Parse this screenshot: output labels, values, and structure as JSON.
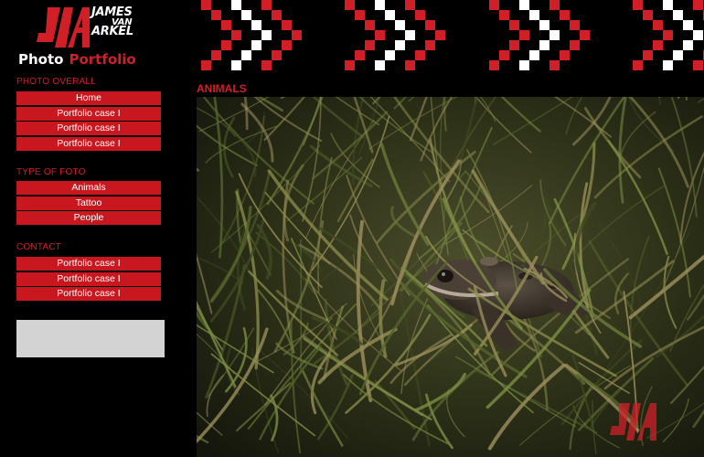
{
  "logo": {
    "monogram": "JVA",
    "name_line1": "JAMES",
    "name_line2": "VAN",
    "name_line3": "ARKEL",
    "tagline_word1": "Photo",
    "tagline_word2": "Portfolio"
  },
  "sidebar": {
    "sections": [
      {
        "title": "PHOTO OVERALL",
        "items": [
          "Home",
          "Portfolio case I",
          "Portfolio case I",
          "Portfolio case I"
        ]
      },
      {
        "title": "TYPE OF FOTO",
        "items": [
          "Animals",
          "Tattoo",
          "People"
        ]
      },
      {
        "title": "CONTACT",
        "items": [
          "Portfolio case I",
          "Portfolio case I",
          "Portfolio case I"
        ]
      }
    ]
  },
  "main": {
    "heading": "ANIMALS",
    "photo_icon": "frog-photo",
    "watermark_text": "JVA"
  },
  "colors": {
    "accent": "#d11f28",
    "background": "#000000",
    "nav_button": "#c8171f",
    "search_box": "#d3d3d3"
  }
}
